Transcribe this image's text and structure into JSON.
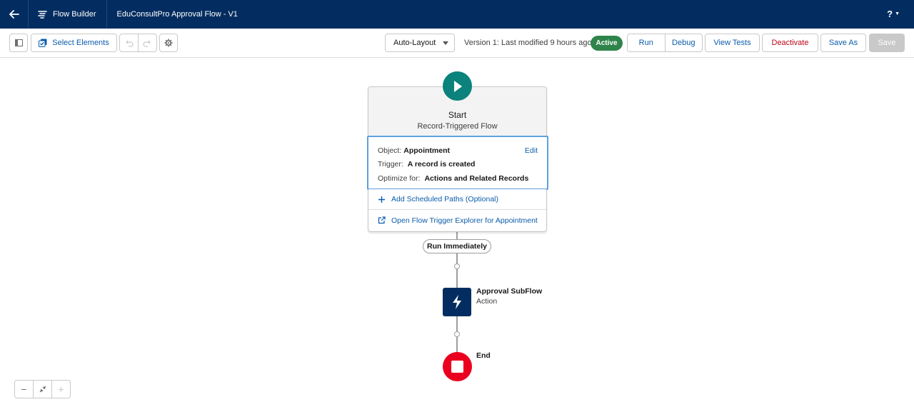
{
  "header": {
    "app_name": "Flow Builder",
    "flow_title": "EduConsultPro Approval Flow - V1",
    "help_label": "?"
  },
  "toolbar": {
    "select_elements_label": "Select Elements",
    "layout_select": "Auto-Layout",
    "version_text": "Version 1: Last modified 9 hours ago",
    "status_badge": "Active",
    "run_label": "Run",
    "debug_label": "Debug",
    "view_tests_label": "View Tests",
    "deactivate_label": "Deactivate",
    "save_as_label": "Save As",
    "save_label": "Save"
  },
  "start_node": {
    "title": "Start",
    "subtitle": "Record-Triggered Flow",
    "object_label": "Object:",
    "object_value": "Appointment",
    "edit_label": "Edit",
    "trigger_label": "Trigger:",
    "trigger_value": "A record is created",
    "optimize_label": "Optimize for:",
    "optimize_value": "Actions and Related Records",
    "add_scheduled_label": "Add Scheduled Paths (Optional)",
    "open_explorer_label": "Open Flow Trigger Explorer for Appointment"
  },
  "path_label": "Run Immediately",
  "action_node": {
    "name": "Approval SubFlow",
    "type": "Action"
  },
  "end_node": {
    "name": "End"
  },
  "colors": {
    "header_bg": "#032d60",
    "start_green": "#0b827c",
    "active_badge": "#2e844a",
    "action_bg": "#032d60",
    "end_red": "#ea001e",
    "link_blue": "#0b5cab"
  }
}
